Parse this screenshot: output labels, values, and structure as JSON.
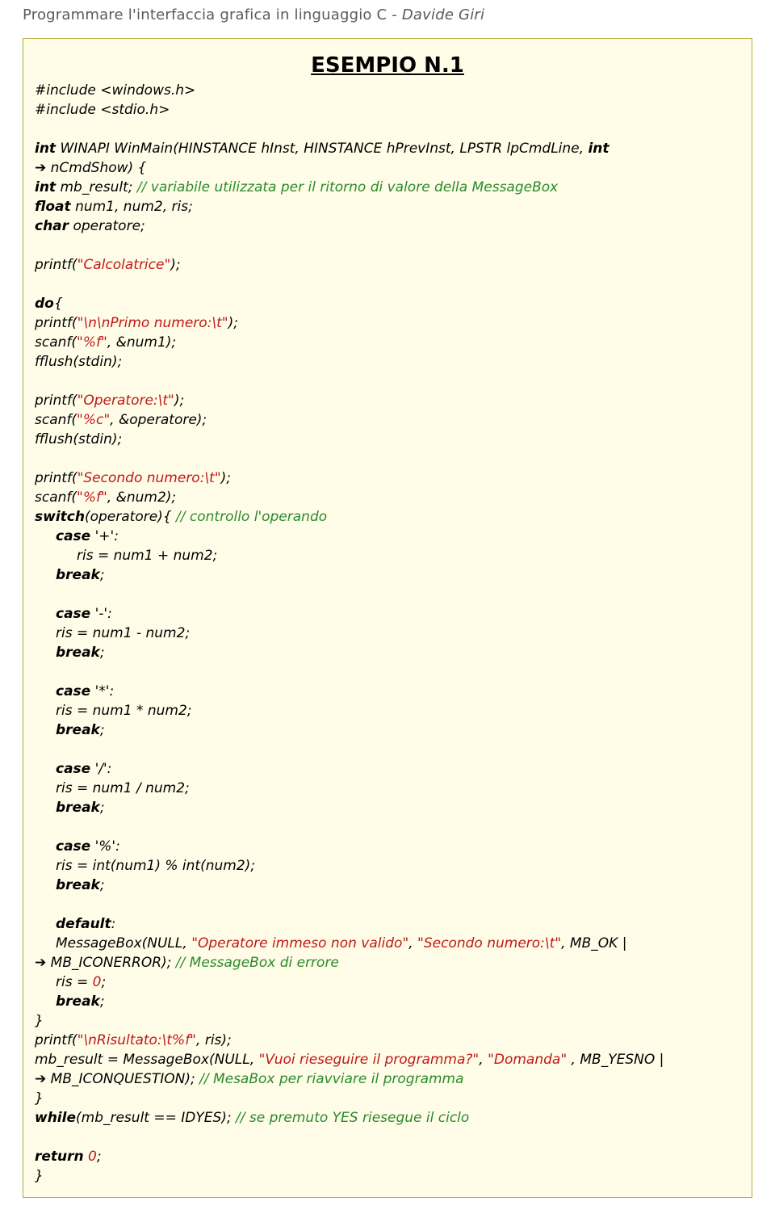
{
  "header": {
    "title": "Programmare l'interfaccia grafica in linguaggio C",
    "sep": "  -  ",
    "author": "Davide Giri"
  },
  "code": {
    "title": "ESEMPIO N.1",
    "inc1a": "#include <windows.h>",
    "inc2a": "#include <stdio.h>",
    "sig1": "int",
    "sig2": " WINAPI WinMain(HINSTANCE hInst, HINSTANCE hPrevInst, LPSTR lpCmdLine, ",
    "sig3": "int",
    "sig_arrow": "➔ ",
    "sig4": "nCmdShow) {",
    "dec1a": "int",
    "dec1b": " mb_result; ",
    "dec1c": "// variabile utilizzata per il ritorno di valore della MessageBox",
    "dec2a": "float",
    "dec2b": " num1, num2, ris;",
    "dec3a": "char",
    "dec3b": " operatore;",
    "p_calc_a": "printf(",
    "p_calc_b": "\"Calcolatrice\"",
    "p_calc_c": ");",
    "do_a": "do",
    "do_b": "{",
    "p_primo_a": "printf(",
    "p_primo_b": "\"\\n\\nPrimo numero:\\t\"",
    "p_primo_c": ");",
    "s_num1_a": "scanf(",
    "s_num1_b": "\"%f\"",
    "s_num1_c": ", &num1);",
    "fflush": "fflush(stdin);",
    "p_op_a": "printf(",
    "p_op_b": "\"Operatore:\\t\"",
    "p_op_c": ");",
    "s_op_a": "scanf(",
    "s_op_b": "\"%c\"",
    "s_op_c": ", &operatore);",
    "p_sec_a": "printf(",
    "p_sec_b": "\"Secondo numero:\\t\"",
    "p_sec_c": ");",
    "s_num2_a": "scanf(",
    "s_num2_b": "\"%f\"",
    "s_num2_c": ", &num2);",
    "switch_a": "switch",
    "switch_b": "(operatore){ ",
    "switch_c": "// controllo l'operando",
    "case_plus_a": "case",
    "case_plus_b": " '+':",
    "case_plus_body": "ris = num1 + num2;",
    "break": "break",
    "semi": ";",
    "case_minus_a": "case",
    "case_minus_b": " '-':",
    "case_minus_body": "ris = num1 - num2;",
    "case_mul_a": "case",
    "case_mul_b": " '*':",
    "case_mul_body": "ris = num1 * num2;",
    "case_div_a": "case",
    "case_div_b": " '/':",
    "case_div_body": "ris = num1 / num2;",
    "case_mod_a": "case",
    "case_mod_b": " '%':",
    "case_mod_body": "ris = int(num1) % int(num2);",
    "default_a": "default",
    "default_b": ":",
    "mb_err_a": "MessageBox(NULL, ",
    "mb_err_b": "\"Operatore immeso non valido\"",
    "mb_err_c": ", ",
    "mb_err_d": "\"Secondo numero:\\t\"",
    "mb_err_e": ", MB_OK |",
    "mb_err_arrow": "➔ ",
    "mb_err_f": "MB_ICONERROR); ",
    "mb_err_g": "// MessageBox di errore",
    "ris0_a": "ris = ",
    "ris0_b": "0",
    "ris0_c": ";",
    "brace_close": "}",
    "p_ris_a": "printf(",
    "p_ris_b": "\"\\nRisultato:\\t%f\"",
    "p_ris_c": ", ris);",
    "mb_q_a": "mb_result = MessageBox(NULL, ",
    "mb_q_b": "\"Vuoi rieseguire il programma?\"",
    "mb_q_c": ", ",
    "mb_q_d": "\"Domanda\"",
    "mb_q_e": " , MB_YESNO |",
    "mb_q_arrow": "➔ ",
    "mb_q_f": "MB_ICONQUESTION); ",
    "mb_q_g": "// MesaBox per riavviare il programma",
    "while_a": "while",
    "while_b": "(mb_result == IDYES); ",
    "while_c": "// se premuto YES riesegue il ciclo",
    "ret_a": "return",
    "ret_b": " ",
    "ret_c": "0",
    "ret_d": ";"
  }
}
